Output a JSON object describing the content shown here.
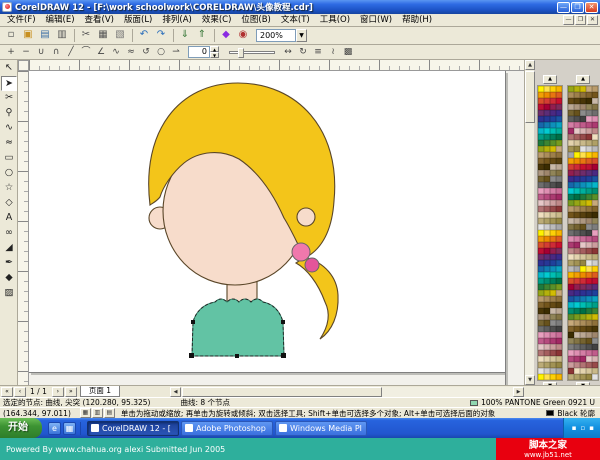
{
  "window": {
    "title": "CorelDRAW 12 - [F:\\work schoolwork\\CORELDRAW\\头像教程.cdr]",
    "minimize": "—",
    "maximize": "❐",
    "close": "✕"
  },
  "menubar": {
    "items": [
      "文件(F)",
      "编辑(E)",
      "查看(V)",
      "版面(L)",
      "排列(A)",
      "效果(C)",
      "位图(B)",
      "文本(T)",
      "工具(O)",
      "窗口(W)",
      "帮助(H)"
    ],
    "doc_controls": [
      {
        "name": "doc-minimize-button",
        "glyph": "—"
      },
      {
        "name": "doc-restore-button",
        "glyph": "❐"
      },
      {
        "name": "doc-close-button",
        "glyph": "✕"
      }
    ]
  },
  "toolbar": {
    "icons": [
      {
        "name": "new-document",
        "glyph": "▫",
        "color": "#555"
      },
      {
        "name": "open-document",
        "glyph": "▣",
        "color": "#C89020"
      },
      {
        "name": "save-document",
        "glyph": "▤",
        "color": "#3B6EA5"
      },
      {
        "name": "print-document",
        "glyph": "▥",
        "color": "#555"
      },
      {
        "sep": true
      },
      {
        "name": "cut",
        "glyph": "✂",
        "color": "#555"
      },
      {
        "name": "copy",
        "glyph": "▦",
        "color": "#555"
      },
      {
        "name": "paste",
        "glyph": "▧",
        "color": "#777"
      },
      {
        "sep": true
      },
      {
        "name": "undo",
        "glyph": "↶",
        "color": "#2A6EBB"
      },
      {
        "name": "redo",
        "glyph": "↷",
        "color": "#2A6EBB"
      },
      {
        "sep": true
      },
      {
        "name": "import",
        "glyph": "⇓",
        "color": "#3A7A3A"
      },
      {
        "name": "export",
        "glyph": "⇑",
        "color": "#3A7A3A"
      },
      {
        "sep": true
      },
      {
        "name": "application-launcher",
        "glyph": "◆",
        "color": "#8A2BE2"
      },
      {
        "name": "corel-online",
        "glyph": "◉",
        "color": "#B03030"
      }
    ],
    "zoom_value": "200%",
    "zoom_dropdown_arrow": "▼"
  },
  "propbar": {
    "icons_left": [
      {
        "name": "add-node",
        "glyph": "+"
      },
      {
        "name": "delete-node",
        "glyph": "−"
      },
      {
        "name": "join-two-nodes",
        "glyph": "∪"
      },
      {
        "name": "break-curve",
        "glyph": "∩"
      },
      {
        "name": "convert-to-line",
        "glyph": "╱"
      },
      {
        "name": "convert-to-curve",
        "glyph": "⌒"
      },
      {
        "name": "make-node-cusp",
        "glyph": "∠"
      },
      {
        "name": "make-node-smooth",
        "glyph": "∿"
      },
      {
        "name": "make-node-symmetrical",
        "glyph": "≈"
      },
      {
        "name": "reverse-curve-direction",
        "glyph": "↺"
      },
      {
        "name": "close-curve",
        "glyph": "○"
      },
      {
        "name": "extract-subpath",
        "glyph": "⇀"
      }
    ],
    "spinner_value": "0",
    "spinner_up": "▲",
    "spinner_down": "▼",
    "icons_right": [
      {
        "name": "stretch-nodes",
        "glyph": "↔"
      },
      {
        "name": "rotate-nodes",
        "glyph": "↻"
      },
      {
        "name": "align-nodes",
        "glyph": "≡"
      },
      {
        "name": "elastic-mode",
        "glyph": "≀"
      },
      {
        "name": "select-all-nodes",
        "glyph": "▩"
      }
    ]
  },
  "toolbox": {
    "tools": [
      {
        "name": "pick-tool",
        "glyph": "↖",
        "active": false
      },
      {
        "name": "shape-tool",
        "glyph": "➤",
        "active": true
      },
      {
        "name": "crop-tool",
        "glyph": "✂",
        "active": false
      },
      {
        "name": "zoom-tool",
        "glyph": "⚲",
        "active": false
      },
      {
        "name": "freehand-tool",
        "glyph": "∿",
        "active": false
      },
      {
        "name": "smart-drawing-tool",
        "glyph": "≈",
        "active": false
      },
      {
        "name": "rectangle-tool",
        "glyph": "▭",
        "active": false
      },
      {
        "name": "ellipse-tool",
        "glyph": "○",
        "active": false
      },
      {
        "name": "polygon-tool",
        "glyph": "☆",
        "active": false
      },
      {
        "name": "basic-shapes-tool",
        "glyph": "◇",
        "active": false
      },
      {
        "name": "text-tool",
        "glyph": "A",
        "active": false
      },
      {
        "name": "interactive-blend-tool",
        "glyph": "∞",
        "active": false
      },
      {
        "name": "eyedropper-tool",
        "glyph": "◢",
        "active": false
      },
      {
        "name": "outline-tool",
        "glyph": "✒",
        "active": false
      },
      {
        "name": "fill-tool",
        "glyph": "◆",
        "active": false
      },
      {
        "name": "interactive-fill-tool",
        "glyph": "▨",
        "active": false
      }
    ]
  },
  "palette": {
    "scroll_up": "▲",
    "scroll_down": "▼",
    "groups": [
      {
        "cols": 4,
        "rows": 49,
        "offset": 0
      },
      {
        "cols": 5,
        "rows": 49,
        "offset": 40
      }
    ],
    "colors": [
      "#FFF200",
      "#FFE14D",
      "#FDD007",
      "#F7B500",
      "#F29F05",
      "#ED8B00",
      "#E87511",
      "#DE5D1F",
      "#D94F2B",
      "#D43D33",
      "#CE2B37",
      "#C8102E",
      "#BE0F34",
      "#A50034",
      "#931E4F",
      "#802A5B",
      "#6E2C6B",
      "#5C2D77",
      "#4A2982",
      "#3B2A8C",
      "#2E3192",
      "#273896",
      "#1F419B",
      "#1B54A3",
      "#1767AB",
      "#127BB3",
      "#0E8FBB",
      "#0AA3C2",
      "#06B7CA",
      "#02CBD1",
      "#00BFB3",
      "#00AF9D",
      "#009F87",
      "#008F71",
      "#007F5B",
      "#006F45",
      "#1E7A3C",
      "#3C8532",
      "#5A9029",
      "#789B1F",
      "#96A616",
      "#B4B10C",
      "#D2BC03",
      "#C7A97B",
      "#B99B6B",
      "#AB8D5B",
      "#9D7F4B",
      "#8F713B",
      "#81632B",
      "#73551B",
      "#654A14",
      "#57400E",
      "#493607",
      "#3B2C01",
      "#C9B9A8",
      "#BBA894",
      "#AD9780",
      "#9F866C",
      "#918558",
      "#837444",
      "#756330",
      "#67521C",
      "#8C8C8C",
      "#7D7D7D",
      "#6E6E6E",
      "#5F5F5F",
      "#505050",
      "#414141",
      "#E8A0BF",
      "#DE8FB2",
      "#D47EA5",
      "#CA6D98",
      "#C05C8B",
      "#B64B7E",
      "#AC3A71",
      "#A22964",
      "#E6C8C8",
      "#D9B3B3",
      "#CC9E9E",
      "#BF8989",
      "#B27474",
      "#A55F5F",
      "#984A4A",
      "#8B3535",
      "#F0E0C0",
      "#E3D3AE",
      "#D6C69C",
      "#C9B98A",
      "#BCAC78",
      "#AFA066",
      "#A29354",
      "#958642",
      "#E3E3E3",
      "#CFCFCF",
      "#BBBBBB",
      "#A7A7A7"
    ]
  },
  "drawing": {
    "hair": "#F3C51A",
    "skin": "#F7DCCB",
    "shirt": "#62C3A4",
    "bead_top": "#F078AC",
    "bead_bottom": "#E4559A"
  },
  "pagebar": {
    "nav_first": "«",
    "nav_prev": "‹",
    "indicator": "1 / 1",
    "nav_next": "›",
    "nav_last": "»",
    "tab": "页面 1"
  },
  "statusbar": {
    "line1_left": "选定的节点: 曲线, 尖突 (120.280, 95.325)",
    "line1_mid": "曲线: 8 个节点",
    "fill_label": "100% PANTONE Green 0921 U",
    "fill_color": "#8FD6B0",
    "line2_left": "(164.344, 97.011)",
    "line2_hint": "单击为拖动或缩放; 再单击为旋转或倾斜; 双击选择工具; Shift+单击可选择多个对象; Alt+单击可选择后面的对象",
    "mini_buttons": [
      {
        "name": "snap-to-grid-toggle",
        "glyph": "▦"
      },
      {
        "name": "snap-to-guides-toggle",
        "glyph": "▥"
      },
      {
        "name": "snap-to-objects-toggle",
        "glyph": "▤"
      }
    ],
    "outline_label": "Black 轮廓",
    "outline_color": "#000000"
  },
  "taskbar": {
    "start_label": "开始",
    "quicklaunch": [
      {
        "name": "internet-explorer-icon",
        "glyph": "e"
      },
      {
        "name": "show-desktop-icon",
        "glyph": "▦"
      }
    ],
    "tasks": [
      {
        "label": "CorelDRAW 12 - [",
        "active": true
      },
      {
        "label": "Adobe Photoshop",
        "active": false
      },
      {
        "label": "Windows Media Pl",
        "active": false
      }
    ],
    "tray_icons": [
      {
        "name": "tray-icon",
        "glyph": "▪"
      },
      {
        "name": "tray-icon",
        "glyph": "▫"
      },
      {
        "name": "tray-icon",
        "glyph": "▪"
      }
    ]
  },
  "banner": {
    "left_text": "Powered By www.chahua.org alexi Submitted Jun 2005",
    "site_name": "脚本之家",
    "site_url": "www.jb51.net"
  }
}
